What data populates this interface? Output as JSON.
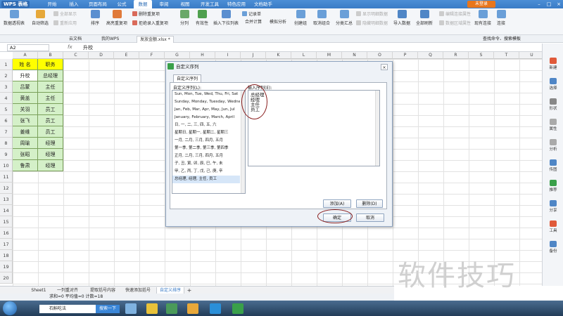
{
  "app": {
    "title": "WPS 表格",
    "login": "未登录"
  },
  "menu_tabs": [
    "开始",
    "插入",
    "页面布局",
    "公式",
    "数据",
    "审阅",
    "视图",
    "开发工具",
    "特色应用",
    "文档助手"
  ],
  "active_menu": "数据",
  "ribbon": {
    "pivot": "数据透视表",
    "autofilter": "自动筛选",
    "show_all": "全部显示",
    "reapply": "重新应用",
    "sort": "排序",
    "highlight_dup": "高亮重复项",
    "delete_dup": "删除重复项",
    "reject_dup": "拒绝录入重复项",
    "split": "分列",
    "validity": "有效性",
    "dropdown": "插入下拉列表",
    "consolidate": "合并计算",
    "record": "记录单",
    "simulate": "模拟分析",
    "group": "创建组",
    "ungroup": "取消组合",
    "subtotal": "分类汇总",
    "show_detail": "显示明细数据",
    "hide_detail": "隐藏明细数据",
    "import": "导入数据",
    "refresh_all": "全部刷新",
    "edit_links": "编辑连接属性",
    "range_props": "数据区域属性",
    "existing": "现有连接",
    "connect": "连接"
  },
  "doc_tabs": [
    "云文档",
    "我的WPS",
    "发放金额.xlsx *"
  ],
  "search_cmd": "查找命令、搜索模板",
  "name_box": "A2",
  "formula": "升校",
  "columns": [
    "A",
    "B",
    "C",
    "D",
    "E",
    "F",
    "G",
    "H",
    "I",
    "J",
    "K",
    "L",
    "M",
    "N",
    "O",
    "P",
    "Q",
    "R",
    "S",
    "T",
    "U"
  ],
  "rows": [
    "1",
    "2",
    "3",
    "4",
    "5",
    "6",
    "7",
    "8",
    "9",
    "10",
    "11",
    "12",
    "13",
    "14",
    "15",
    "16",
    "17",
    "18",
    "19",
    "20"
  ],
  "table": {
    "headers": [
      "姓 名",
      "职务"
    ],
    "data": [
      [
        "升校",
        "总经理"
      ],
      [
        "吕蒙",
        "主任"
      ],
      [
        "黄盖",
        "主任"
      ],
      [
        "关羽",
        "员工"
      ],
      [
        "张飞",
        "员工"
      ],
      [
        "姜维",
        "员工"
      ],
      [
        "周瑜",
        "经理"
      ],
      [
        "张昭",
        "经理"
      ],
      [
        "鲁肃",
        "经理"
      ]
    ]
  },
  "dialog": {
    "title": "自定义序列",
    "tab": "自定义序列",
    "list_label": "自定义序列(L):",
    "entry_label": "输入序列(E):",
    "list_items": [
      "Sun, Mon, Tue, Wed, Thu, Fri, Sat",
      "Sunday, Monday, Tuesday, Wednesday",
      "Jan, Feb, Mar, Apr, May, Jun, Jul",
      "January, February, March, April",
      "日, 一, 二, 三, 四, 五, 六",
      "星期日, 星期一, 星期二, 星期三",
      "一月, 二月, 三月, 四月, 五月",
      "第一季, 第二季, 第三季, 第四季",
      "正月, 二月, 三月, 四月, 五月",
      "子, 丑, 寅, 卯, 辰, 巳, 午, 未",
      "甲, 乙, 丙, 丁, 戊, 己, 庚, 辛",
      "总经理, 经理, 主任, 员工"
    ],
    "entries": [
      "总经理",
      "经理",
      "主任",
      "员工"
    ],
    "add": "添加(A)",
    "delete": "删除(D)",
    "ok": "确定",
    "cancel": "取消"
  },
  "side_panel": [
    "新建",
    "选择",
    "形状",
    "属性",
    "分析",
    "传图",
    "推荐",
    "分享",
    "工具",
    "备份"
  ],
  "sheet_tabs": [
    "Sheet1",
    "一列重对齐",
    "提取括号内容",
    "快速添加括号",
    "自定义排序"
  ],
  "status": "求和=0  平均值=0  计数=18",
  "taskbar": {
    "search_text": "石斛吃法",
    "search_btn": "搜索一下"
  },
  "watermark": "软件技巧",
  "colors": {
    "table_fill": "#d4f0c8",
    "header_fill": "#ffff00",
    "accent": "#3a7bc6",
    "annotation": "#8a1f1f"
  }
}
